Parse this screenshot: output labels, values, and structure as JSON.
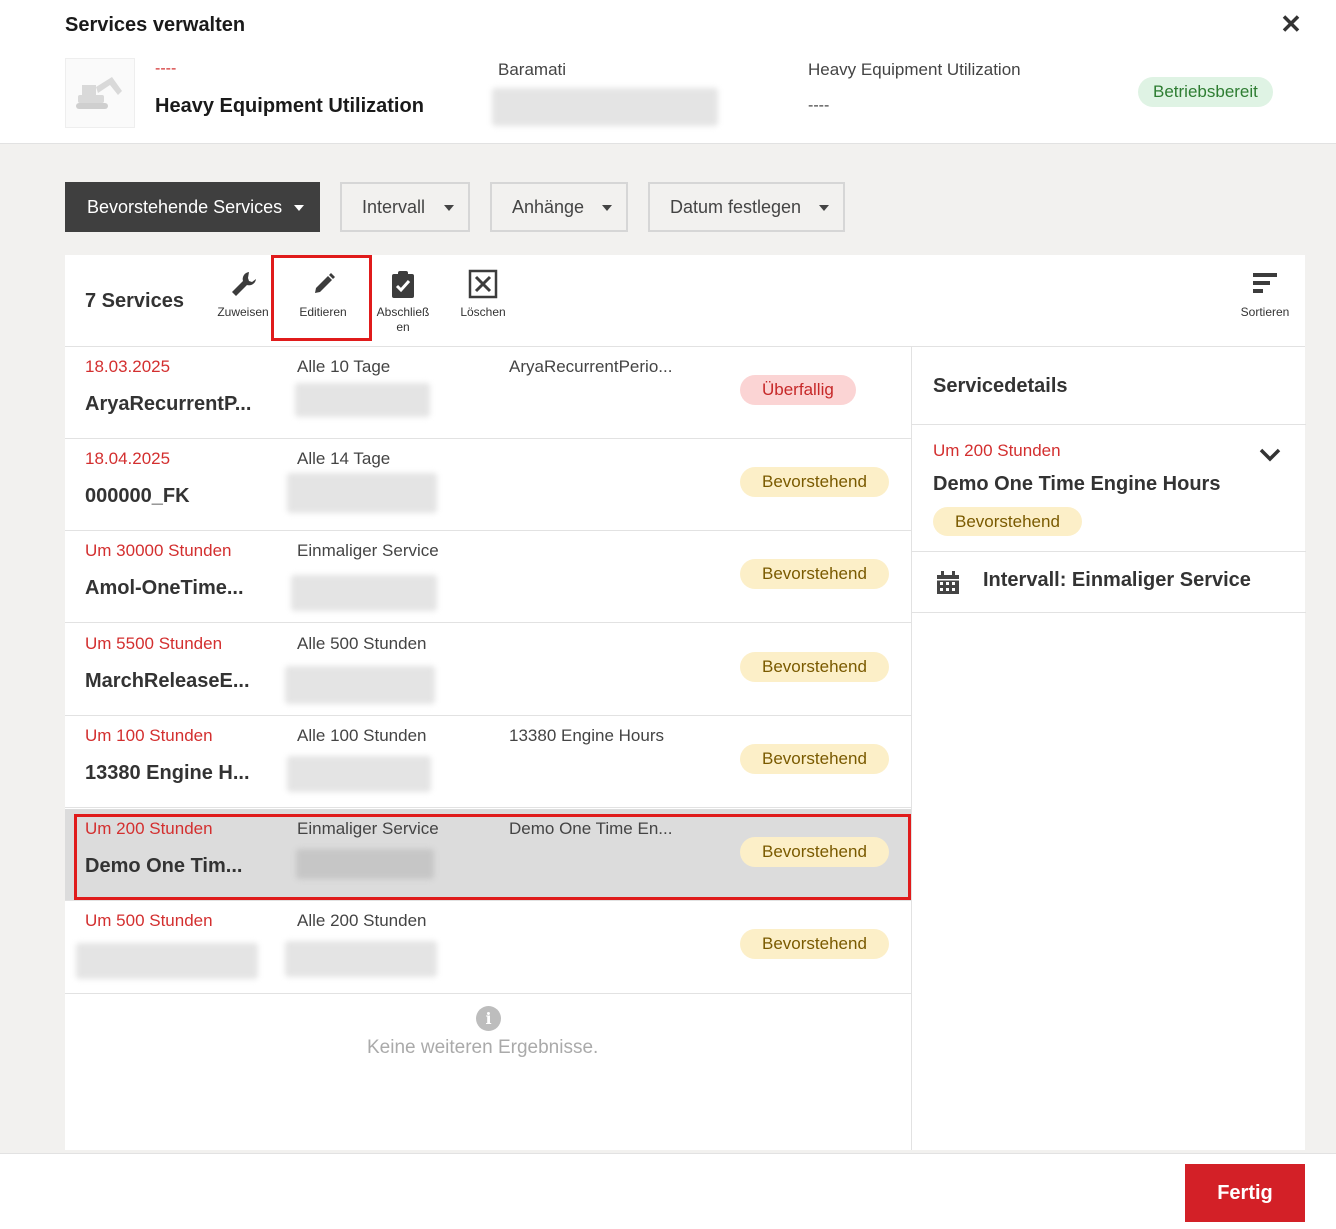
{
  "dialog": {
    "title": "Services verwalten"
  },
  "asset": {
    "dash": "----",
    "name": "Heavy Equipment Utilization",
    "location_label": "Baramati",
    "type_label": "Heavy Equipment Utilization",
    "type_value": "----",
    "status": "Betriebsbereit"
  },
  "filters": {
    "view": "Bevorstehende Services",
    "interval": "Intervall",
    "attachments": "Anhänge",
    "date": "Datum festlegen"
  },
  "toolbar": {
    "count": "7 Services",
    "assign": "Zuweisen",
    "edit": "Editieren",
    "complete": "Abschließ en",
    "delete": "Löschen",
    "sort": "Sortieren"
  },
  "services": [
    {
      "due": "18.03.2025",
      "name": "AryaRecurrentP...",
      "interval": "Alle 10 Tage",
      "desc": "AryaRecurrentPerio...",
      "status": "Überfallig"
    },
    {
      "due": "18.04.2025",
      "name": "000000_FK",
      "interval": "Alle 14 Tage",
      "desc": "",
      "status": "Bevorstehend"
    },
    {
      "due": "Um 30000 Stunden",
      "name": "Amol-OneTime...",
      "interval": "Einmaliger Service",
      "desc": "",
      "status": "Bevorstehend"
    },
    {
      "due": "Um 5500 Stunden",
      "name": "MarchReleaseE...",
      "interval": "Alle 500 Stunden",
      "desc": "",
      "status": "Bevorstehend"
    },
    {
      "due": "Um 100 Stunden",
      "name": "13380 Engine H...",
      "interval": "Alle 100 Stunden",
      "desc": "13380 Engine Hours",
      "status": "Bevorstehend"
    },
    {
      "due": "Um 200 Stunden",
      "name": "Demo One Tim...",
      "interval": "Einmaliger Service",
      "desc": "Demo One Time En...",
      "status": "Bevorstehend"
    },
    {
      "due": "Um 500 Stunden",
      "name": "",
      "interval": "Alle 200 Stunden",
      "desc": "",
      "status": "Bevorstehend"
    }
  ],
  "no_more": "Keine weiteren Ergebnisse.",
  "detail": {
    "title": "Servicedetails",
    "due": "Um 200 Stunden",
    "name": "Demo One Time Engine Hours",
    "status": "Bevorstehend",
    "interval": "Intervall: Einmaliger Service"
  },
  "footer": {
    "done": "Fertig"
  },
  "colors": {
    "accent": "#d32027",
    "overdue_bg": "#fbd4d4",
    "upcoming_bg": "#fcefc8",
    "ready_bg": "#dff3e4"
  }
}
